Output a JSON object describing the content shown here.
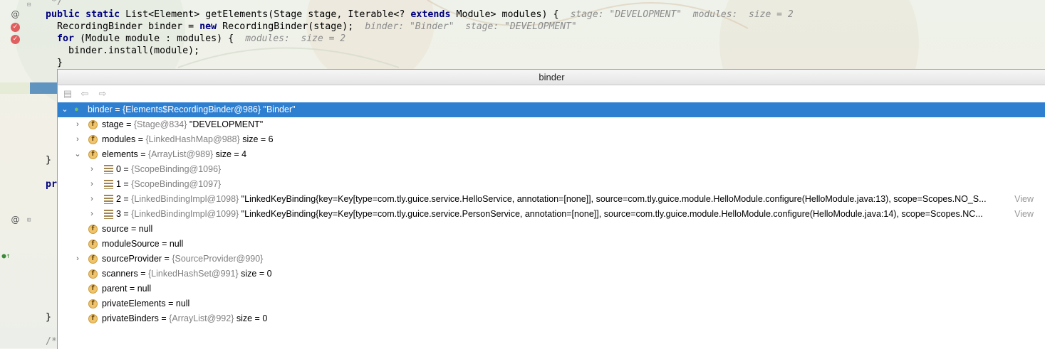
{
  "code": {
    "comment_top": "*/",
    "line1": {
      "prefix": "public static ",
      "kw_public": "public",
      "kw_static": "static",
      "rest": "List<Element> getElements(Stage stage, Iterable<? ",
      "kw_extends": "extends",
      "rest2": " Module> modules) {",
      "hint": "stage: \"DEVELOPMENT\"  modules:  size = 2"
    },
    "line2": {
      "text1": "RecordingBinder binder = ",
      "kw_new": "new",
      "text2": " RecordingBinder(stage);",
      "hint": "binder: \"Binder\"  stage: \"DEVELOPMENT\""
    },
    "line3": {
      "kw_for": "for",
      "text": " (Module module : modules) {",
      "hint": "modules:  size = 2"
    },
    "line4": {
      "text": "binder.install(module);"
    },
    "line5": {
      "text": "}"
    },
    "close1": "}",
    "pr": "pr",
    "close2": "}",
    "comment_bottom": "/*"
  },
  "popup": {
    "title": "binder",
    "view_label": "View"
  },
  "tree": {
    "root": {
      "name": "binder",
      "eq": " = ",
      "type": "{Elements$RecordingBinder@986}",
      "value": " \"Binder\""
    },
    "stage": {
      "name": "stage",
      "eq": " = ",
      "type": "{Stage@834}",
      "value": " \"DEVELOPMENT\""
    },
    "modules": {
      "name": "modules",
      "eq": " = ",
      "type": "{LinkedHashMap@988}",
      "value": "  size = 6"
    },
    "elements": {
      "name": "elements",
      "eq": " = ",
      "type": "{ArrayList@989}",
      "value": "  size = 4"
    },
    "el0": {
      "name": "0",
      "eq": " = ",
      "type": "{ScopeBinding@1096}",
      "value": ""
    },
    "el1": {
      "name": "1",
      "eq": " = ",
      "type": "{ScopeBinding@1097}",
      "value": ""
    },
    "el2": {
      "name": "2",
      "eq": " = ",
      "type": "{LinkedBindingImpl@1098}",
      "value": " \"LinkedKeyBinding{key=Key[type=com.tly.guice.service.HelloService, annotation=[none]], source=com.tly.guice.module.HelloModule.configure(HelloModule.java:13), scope=Scopes.NO_S..."
    },
    "el3": {
      "name": "3",
      "eq": " = ",
      "type": "{LinkedBindingImpl@1099}",
      "value": " \"LinkedKeyBinding{key=Key[type=com.tly.guice.service.PersonService, annotation=[none]], source=com.tly.guice.module.HelloModule.configure(HelloModule.java:14), scope=Scopes.NC..."
    },
    "source": {
      "name": "source",
      "eq": " = ",
      "value": "null"
    },
    "moduleSource": {
      "name": "moduleSource",
      "eq": " = ",
      "value": "null"
    },
    "sourceProvider": {
      "name": "sourceProvider",
      "eq": " = ",
      "type": "{SourceProvider@990}",
      "value": ""
    },
    "scanners": {
      "name": "scanners",
      "eq": " = ",
      "type": "{LinkedHashSet@991}",
      "value": "  size = 0"
    },
    "parent": {
      "name": "parent",
      "eq": " = ",
      "value": "null"
    },
    "privateElements": {
      "name": "privateElements",
      "eq": " = ",
      "value": "null"
    },
    "privateBinders": {
      "name": "privateBinders",
      "eq": " = ",
      "type": "{ArrayList@992}",
      "value": "  size = 0"
    }
  },
  "icons": {
    "field_letter": "f",
    "breakpoint_mark": "✓",
    "override_mark": "@",
    "expand_arrow": "›",
    "collapse_arrow": "⌄"
  },
  "colors": {
    "selection": "#2f7fd1",
    "keyword": "#000080",
    "breakpoint": "#e05f5f"
  }
}
